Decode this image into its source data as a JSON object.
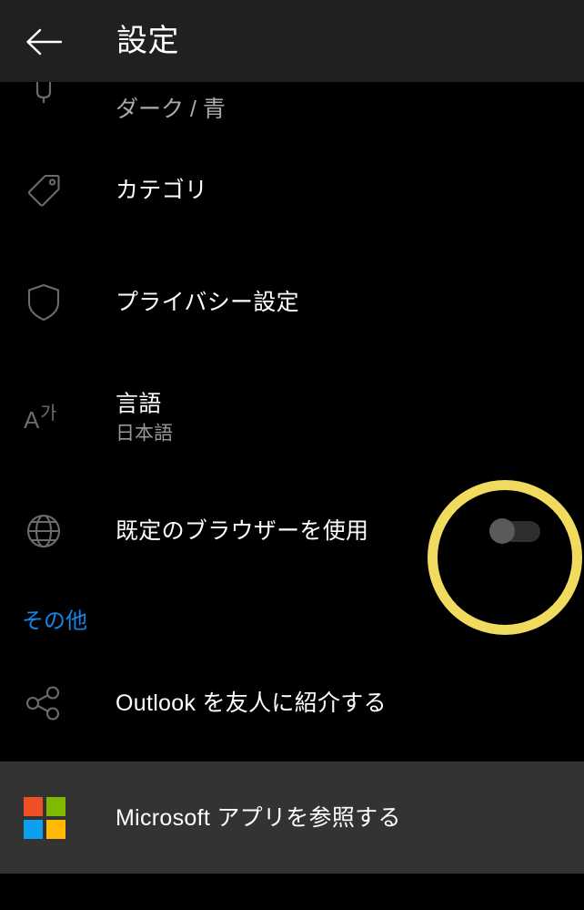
{
  "app": {
    "title": "設定",
    "back_icon": "back-arrow-icon",
    "header_bg": "#202020",
    "body_bg": "#000000"
  },
  "settings_list": [
    {
      "id": "theme",
      "icon": "theme-paint-icon",
      "title": "",
      "subtitle": "ダーク / 青",
      "partial": true
    },
    {
      "id": "category",
      "icon": "tag-icon",
      "title": "カテゴリ",
      "subtitle": ""
    },
    {
      "id": "privacy",
      "icon": "shield-icon",
      "title": "プライバシー設定",
      "subtitle": ""
    },
    {
      "id": "language",
      "icon": "translate-icon",
      "title": "言語",
      "subtitle": "日本語"
    },
    {
      "id": "default-browser",
      "icon": "globe-icon",
      "title": "既定のブラウザーを使用",
      "subtitle": "",
      "toggle": {
        "state": "off",
        "thumb_color": "#5a5a5a",
        "track_color": "#2e2e2e"
      }
    }
  ],
  "section_other": {
    "label": "その他",
    "color": "#1386e8",
    "items": [
      {
        "id": "refer-outlook",
        "icon": "share-icon",
        "title": "Outlook を友人に紹介する"
      },
      {
        "id": "browse-microsoft-apps",
        "icon": "microsoft-logo-icon",
        "title": "Microsoft アプリを参照する",
        "bg": "#333333"
      }
    ]
  },
  "annotation": {
    "type": "highlight-ring",
    "color": "#f0db5e",
    "target": "default-browser-toggle"
  },
  "ms_logo_colors": {
    "top_left": "#ef4f24",
    "top_right": "#7fba00",
    "bottom_left": "#0ca0ef",
    "bottom_right": "#ffb900"
  }
}
